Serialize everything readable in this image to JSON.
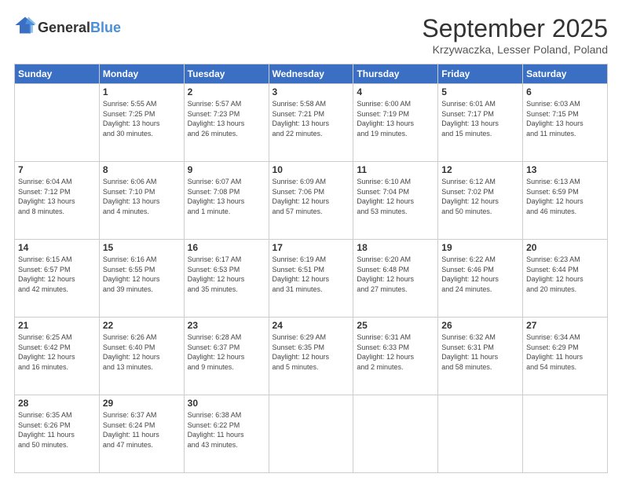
{
  "logo": {
    "general": "General",
    "blue": "Blue"
  },
  "header": {
    "month": "September 2025",
    "location": "Krzywaczka, Lesser Poland, Poland"
  },
  "weekdays": [
    "Sunday",
    "Monday",
    "Tuesday",
    "Wednesday",
    "Thursday",
    "Friday",
    "Saturday"
  ],
  "weeks": [
    [
      {
        "day": "",
        "info": ""
      },
      {
        "day": "1",
        "info": "Sunrise: 5:55 AM\nSunset: 7:25 PM\nDaylight: 13 hours\nand 30 minutes."
      },
      {
        "day": "2",
        "info": "Sunrise: 5:57 AM\nSunset: 7:23 PM\nDaylight: 13 hours\nand 26 minutes."
      },
      {
        "day": "3",
        "info": "Sunrise: 5:58 AM\nSunset: 7:21 PM\nDaylight: 13 hours\nand 22 minutes."
      },
      {
        "day": "4",
        "info": "Sunrise: 6:00 AM\nSunset: 7:19 PM\nDaylight: 13 hours\nand 19 minutes."
      },
      {
        "day": "5",
        "info": "Sunrise: 6:01 AM\nSunset: 7:17 PM\nDaylight: 13 hours\nand 15 minutes."
      },
      {
        "day": "6",
        "info": "Sunrise: 6:03 AM\nSunset: 7:15 PM\nDaylight: 13 hours\nand 11 minutes."
      }
    ],
    [
      {
        "day": "7",
        "info": "Sunrise: 6:04 AM\nSunset: 7:12 PM\nDaylight: 13 hours\nand 8 minutes."
      },
      {
        "day": "8",
        "info": "Sunrise: 6:06 AM\nSunset: 7:10 PM\nDaylight: 13 hours\nand 4 minutes."
      },
      {
        "day": "9",
        "info": "Sunrise: 6:07 AM\nSunset: 7:08 PM\nDaylight: 13 hours\nand 1 minute."
      },
      {
        "day": "10",
        "info": "Sunrise: 6:09 AM\nSunset: 7:06 PM\nDaylight: 12 hours\nand 57 minutes."
      },
      {
        "day": "11",
        "info": "Sunrise: 6:10 AM\nSunset: 7:04 PM\nDaylight: 12 hours\nand 53 minutes."
      },
      {
        "day": "12",
        "info": "Sunrise: 6:12 AM\nSunset: 7:02 PM\nDaylight: 12 hours\nand 50 minutes."
      },
      {
        "day": "13",
        "info": "Sunrise: 6:13 AM\nSunset: 6:59 PM\nDaylight: 12 hours\nand 46 minutes."
      }
    ],
    [
      {
        "day": "14",
        "info": "Sunrise: 6:15 AM\nSunset: 6:57 PM\nDaylight: 12 hours\nand 42 minutes."
      },
      {
        "day": "15",
        "info": "Sunrise: 6:16 AM\nSunset: 6:55 PM\nDaylight: 12 hours\nand 39 minutes."
      },
      {
        "day": "16",
        "info": "Sunrise: 6:17 AM\nSunset: 6:53 PM\nDaylight: 12 hours\nand 35 minutes."
      },
      {
        "day": "17",
        "info": "Sunrise: 6:19 AM\nSunset: 6:51 PM\nDaylight: 12 hours\nand 31 minutes."
      },
      {
        "day": "18",
        "info": "Sunrise: 6:20 AM\nSunset: 6:48 PM\nDaylight: 12 hours\nand 27 minutes."
      },
      {
        "day": "19",
        "info": "Sunrise: 6:22 AM\nSunset: 6:46 PM\nDaylight: 12 hours\nand 24 minutes."
      },
      {
        "day": "20",
        "info": "Sunrise: 6:23 AM\nSunset: 6:44 PM\nDaylight: 12 hours\nand 20 minutes."
      }
    ],
    [
      {
        "day": "21",
        "info": "Sunrise: 6:25 AM\nSunset: 6:42 PM\nDaylight: 12 hours\nand 16 minutes."
      },
      {
        "day": "22",
        "info": "Sunrise: 6:26 AM\nSunset: 6:40 PM\nDaylight: 12 hours\nand 13 minutes."
      },
      {
        "day": "23",
        "info": "Sunrise: 6:28 AM\nSunset: 6:37 PM\nDaylight: 12 hours\nand 9 minutes."
      },
      {
        "day": "24",
        "info": "Sunrise: 6:29 AM\nSunset: 6:35 PM\nDaylight: 12 hours\nand 5 minutes."
      },
      {
        "day": "25",
        "info": "Sunrise: 6:31 AM\nSunset: 6:33 PM\nDaylight: 12 hours\nand 2 minutes."
      },
      {
        "day": "26",
        "info": "Sunrise: 6:32 AM\nSunset: 6:31 PM\nDaylight: 11 hours\nand 58 minutes."
      },
      {
        "day": "27",
        "info": "Sunrise: 6:34 AM\nSunset: 6:29 PM\nDaylight: 11 hours\nand 54 minutes."
      }
    ],
    [
      {
        "day": "28",
        "info": "Sunrise: 6:35 AM\nSunset: 6:26 PM\nDaylight: 11 hours\nand 50 minutes."
      },
      {
        "day": "29",
        "info": "Sunrise: 6:37 AM\nSunset: 6:24 PM\nDaylight: 11 hours\nand 47 minutes."
      },
      {
        "day": "30",
        "info": "Sunrise: 6:38 AM\nSunset: 6:22 PM\nDaylight: 11 hours\nand 43 minutes."
      },
      {
        "day": "",
        "info": ""
      },
      {
        "day": "",
        "info": ""
      },
      {
        "day": "",
        "info": ""
      },
      {
        "day": "",
        "info": ""
      }
    ]
  ]
}
